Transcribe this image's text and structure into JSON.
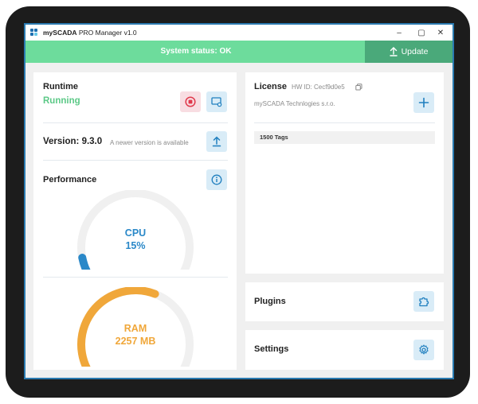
{
  "window": {
    "app_name": "mySCADA",
    "title_rest": " PRO Manager v1.0",
    "minimize": "–",
    "maximize": "▢",
    "close": "✕"
  },
  "status": {
    "text": "System status: OK",
    "update_label": "Update"
  },
  "runtime": {
    "label": "Runtime",
    "state": "Running"
  },
  "version": {
    "label": "Version: 9.3.0",
    "note": "A newer version is available"
  },
  "performance": {
    "label": "Performance",
    "cpu": {
      "name": "CPU",
      "value_text": "15%",
      "fraction": 0.15
    },
    "ram": {
      "name": "RAM",
      "value_text": "2257 MB",
      "fraction": 0.62
    }
  },
  "license": {
    "label": "License",
    "hw_id": "HW ID: Cecf9d0e5",
    "company": "mySCADA Technlogies s.r.o.",
    "tags": "1500 Tags"
  },
  "plugins": {
    "label": "Plugins"
  },
  "settings": {
    "label": "Settings"
  },
  "colors": {
    "status_green": "#6ddc9c",
    "update_green": "#4aa97a",
    "running_green": "#5cc987",
    "cpu_blue": "#2a88c8",
    "ram_orange": "#f0a73a",
    "stop_red": "#e0384b",
    "accent_blue": "#1f7fbf"
  }
}
